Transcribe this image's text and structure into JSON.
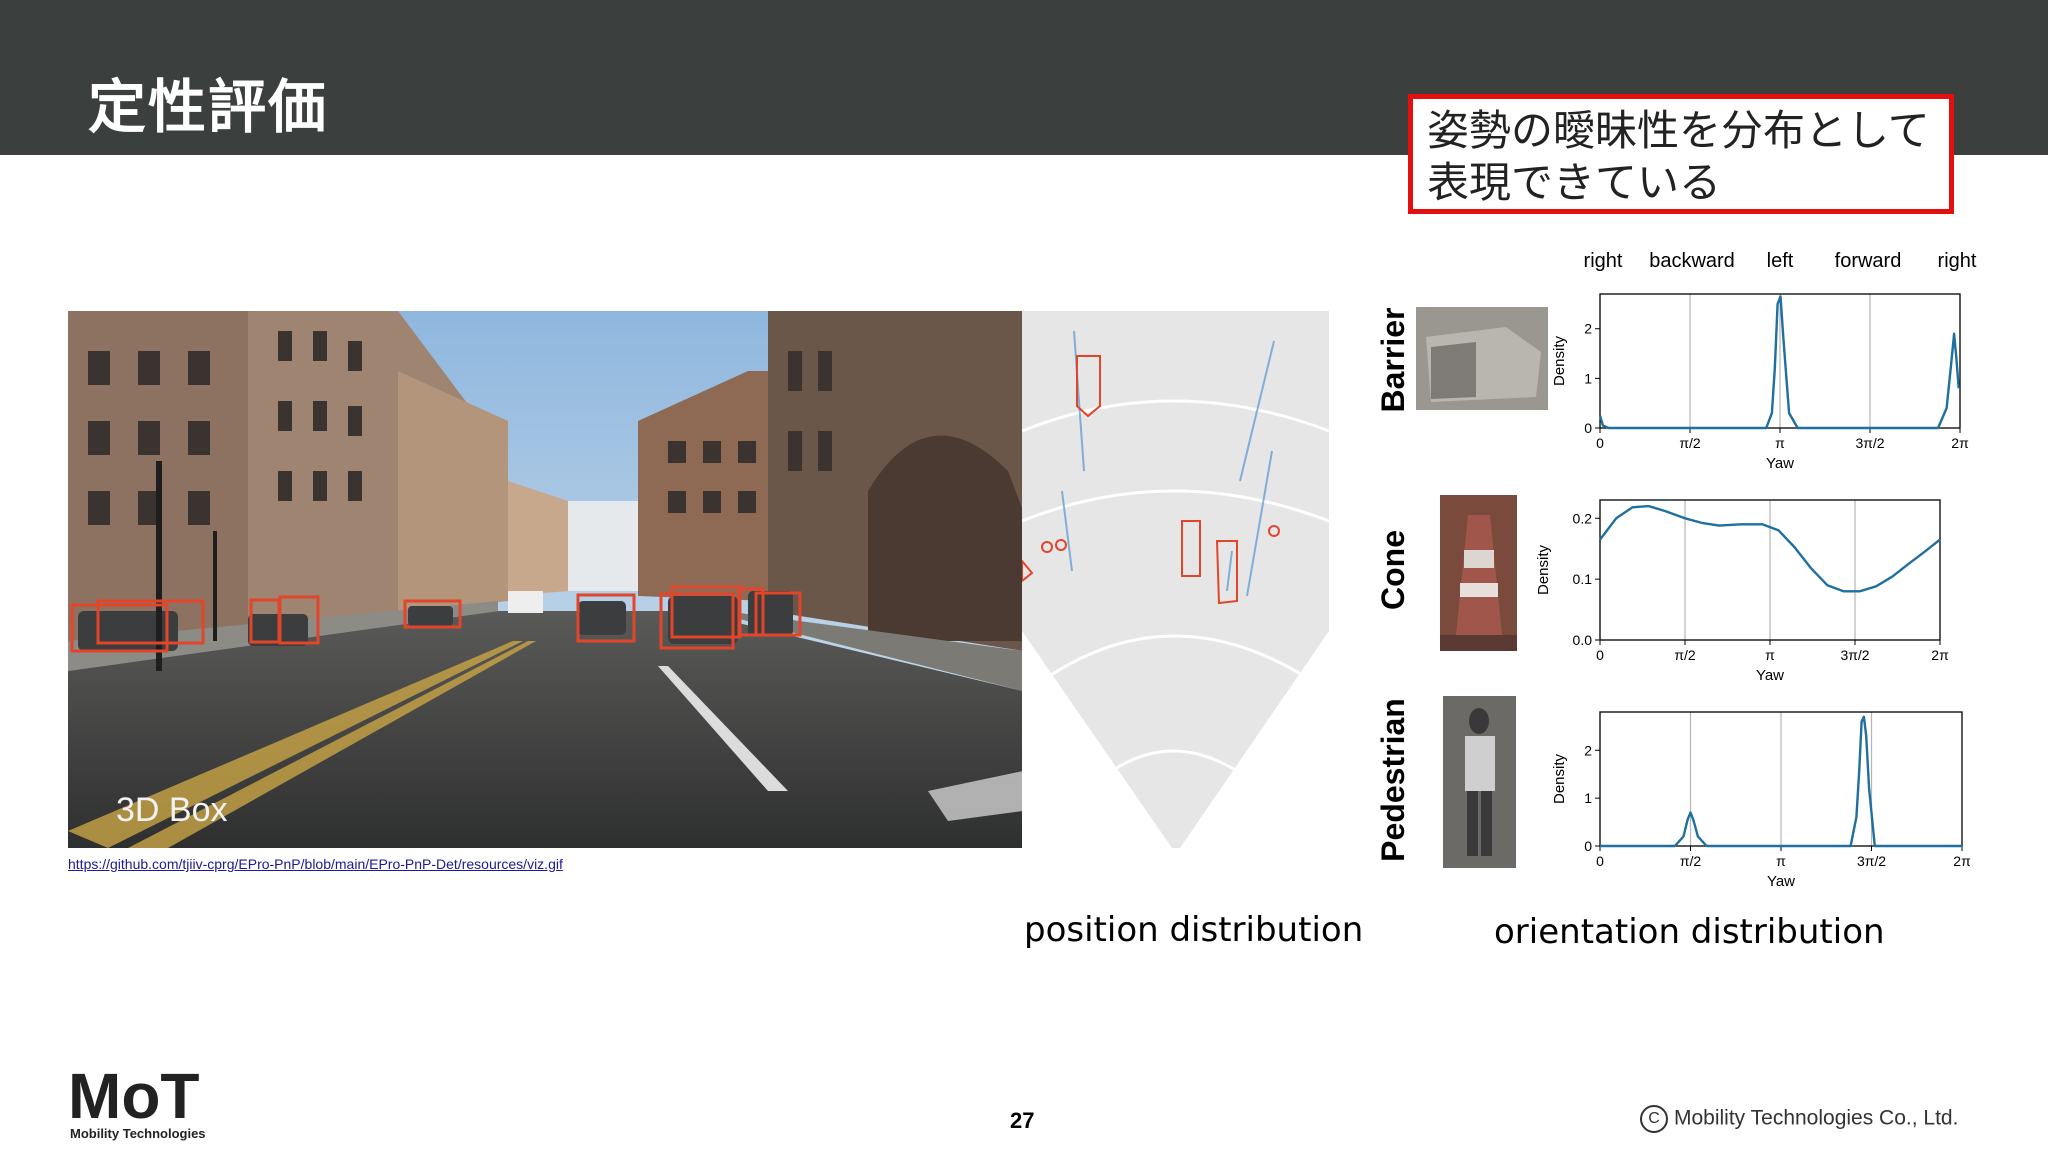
{
  "slide": {
    "title": "定性評価",
    "callout_line1": "姿勢の曖昧性を分布として",
    "callout_line2": "表現できている",
    "scene_label": "3D Box",
    "source_url": "https://github.com/tjiiv-cprg/EPro-PnP/blob/main/EPro-PnP-Det/resources/viz.gif",
    "position_caption": "position distribution",
    "orientation_caption": "orientation distribution",
    "page_number": "27",
    "copyright": "Mobility Technologies Co., Ltd.",
    "logo_text": "MoT",
    "logo_subtext": "Mobility Technologies"
  },
  "directions": [
    "right",
    "backward",
    "left",
    "forward",
    "right"
  ],
  "colors": {
    "header_bg": "#3b3f3d",
    "callout_border": "#e3100f",
    "curve": "#1f6f9f",
    "box": "#e2452a"
  },
  "chart_data": [
    {
      "type": "line",
      "row_label": "Barrier",
      "xlabel": "Yaw",
      "ylabel": "Density",
      "xtick_labels": [
        "0",
        "π/2",
        "π",
        "3π/2",
        "2π"
      ],
      "ytick_labels": [
        "0",
        "1",
        "2"
      ],
      "xlim": [
        0,
        6.283
      ],
      "ylim": [
        0,
        2.7
      ],
      "grid": "vertical lines at π/2, π, 3π/2",
      "x": [
        0.0,
        0.05,
        0.15,
        2.9,
        3.0,
        3.05,
        3.1,
        3.15,
        3.2,
        3.3,
        3.45,
        5.9,
        6.05,
        6.13,
        6.18,
        6.22,
        6.26
      ],
      "y": [
        0.25,
        0.05,
        0.0,
        0.0,
        0.3,
        1.2,
        2.5,
        2.65,
        1.8,
        0.3,
        0.0,
        0.0,
        0.4,
        1.3,
        1.9,
        1.4,
        0.8
      ]
    },
    {
      "type": "line",
      "row_label": "Cone",
      "xlabel": "Yaw",
      "ylabel": "Density",
      "xtick_labels": [
        "0",
        "π/2",
        "π",
        "3π/2",
        "2π"
      ],
      "ytick_labels": [
        "0.0",
        "0.1",
        "0.2"
      ],
      "xlim": [
        0,
        6.283
      ],
      "ylim": [
        0,
        0.23
      ],
      "grid": "vertical lines at π/2, π, 3π/2",
      "x": [
        0.0,
        0.3,
        0.6,
        0.9,
        1.2,
        1.57,
        1.9,
        2.2,
        2.6,
        3.0,
        3.3,
        3.6,
        3.9,
        4.2,
        4.5,
        4.8,
        5.1,
        5.4,
        5.7,
        6.0,
        6.283
      ],
      "y": [
        0.165,
        0.2,
        0.218,
        0.22,
        0.212,
        0.2,
        0.192,
        0.188,
        0.19,
        0.19,
        0.18,
        0.152,
        0.118,
        0.09,
        0.08,
        0.08,
        0.088,
        0.104,
        0.125,
        0.145,
        0.165
      ]
    },
    {
      "type": "line",
      "row_label": "Pedestrian",
      "xlabel": "Yaw",
      "ylabel": "Density",
      "xtick_labels": [
        "0",
        "π/2",
        "π",
        "3π/2",
        "2π"
      ],
      "ytick_labels": [
        "0",
        "1",
        "2"
      ],
      "xlim": [
        0,
        6.283
      ],
      "ylim": [
        0,
        2.8
      ],
      "grid": "vertical lines at π/2, π, 3π/2",
      "x": [
        0.0,
        1.3,
        1.45,
        1.52,
        1.57,
        1.62,
        1.7,
        1.85,
        4.35,
        4.45,
        4.5,
        4.54,
        4.58,
        4.62,
        4.67,
        4.77,
        6.283
      ],
      "y": [
        0.0,
        0.0,
        0.2,
        0.55,
        0.7,
        0.55,
        0.2,
        0.0,
        0.0,
        0.6,
        1.6,
        2.6,
        2.7,
        2.3,
        1.2,
        0.0,
        0.0
      ]
    }
  ]
}
